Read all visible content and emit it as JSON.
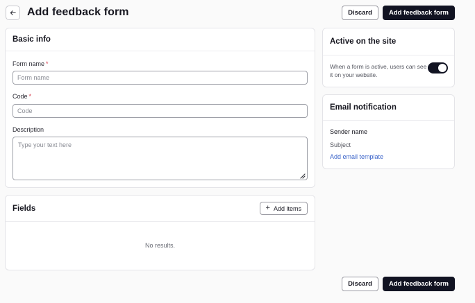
{
  "header": {
    "title": "Add feedback form",
    "discard_label": "Discard",
    "submit_label": "Add feedback form"
  },
  "basic_info": {
    "title": "Basic info",
    "form_name": {
      "label": "Form name",
      "required_mark": "*",
      "placeholder": "Form name",
      "value": ""
    },
    "code": {
      "label": "Code",
      "required_mark": "*",
      "placeholder": "Code",
      "value": ""
    },
    "description": {
      "label": "Description",
      "placeholder": "Type your text here",
      "value": ""
    }
  },
  "fields": {
    "title": "Fields",
    "add_items_label": "Add items",
    "empty_text": "No results."
  },
  "active": {
    "title": "Active on the site",
    "description": "When a form is active, users can see it on your website.",
    "enabled": true
  },
  "email_notification": {
    "title": "Email notification",
    "sender_name": "Sender name",
    "subject": "Subject",
    "template_link": "Add email template"
  },
  "footer": {
    "discard_label": "Discard",
    "submit_label": "Add feedback form"
  },
  "icons": {
    "back": "arrow-left-icon",
    "add": "plus-icon",
    "resize": "resize-handle-icon"
  },
  "colors": {
    "primary": "#111322",
    "required": "#d43a4a",
    "link": "#3a63c9",
    "background": "#fafafa"
  }
}
